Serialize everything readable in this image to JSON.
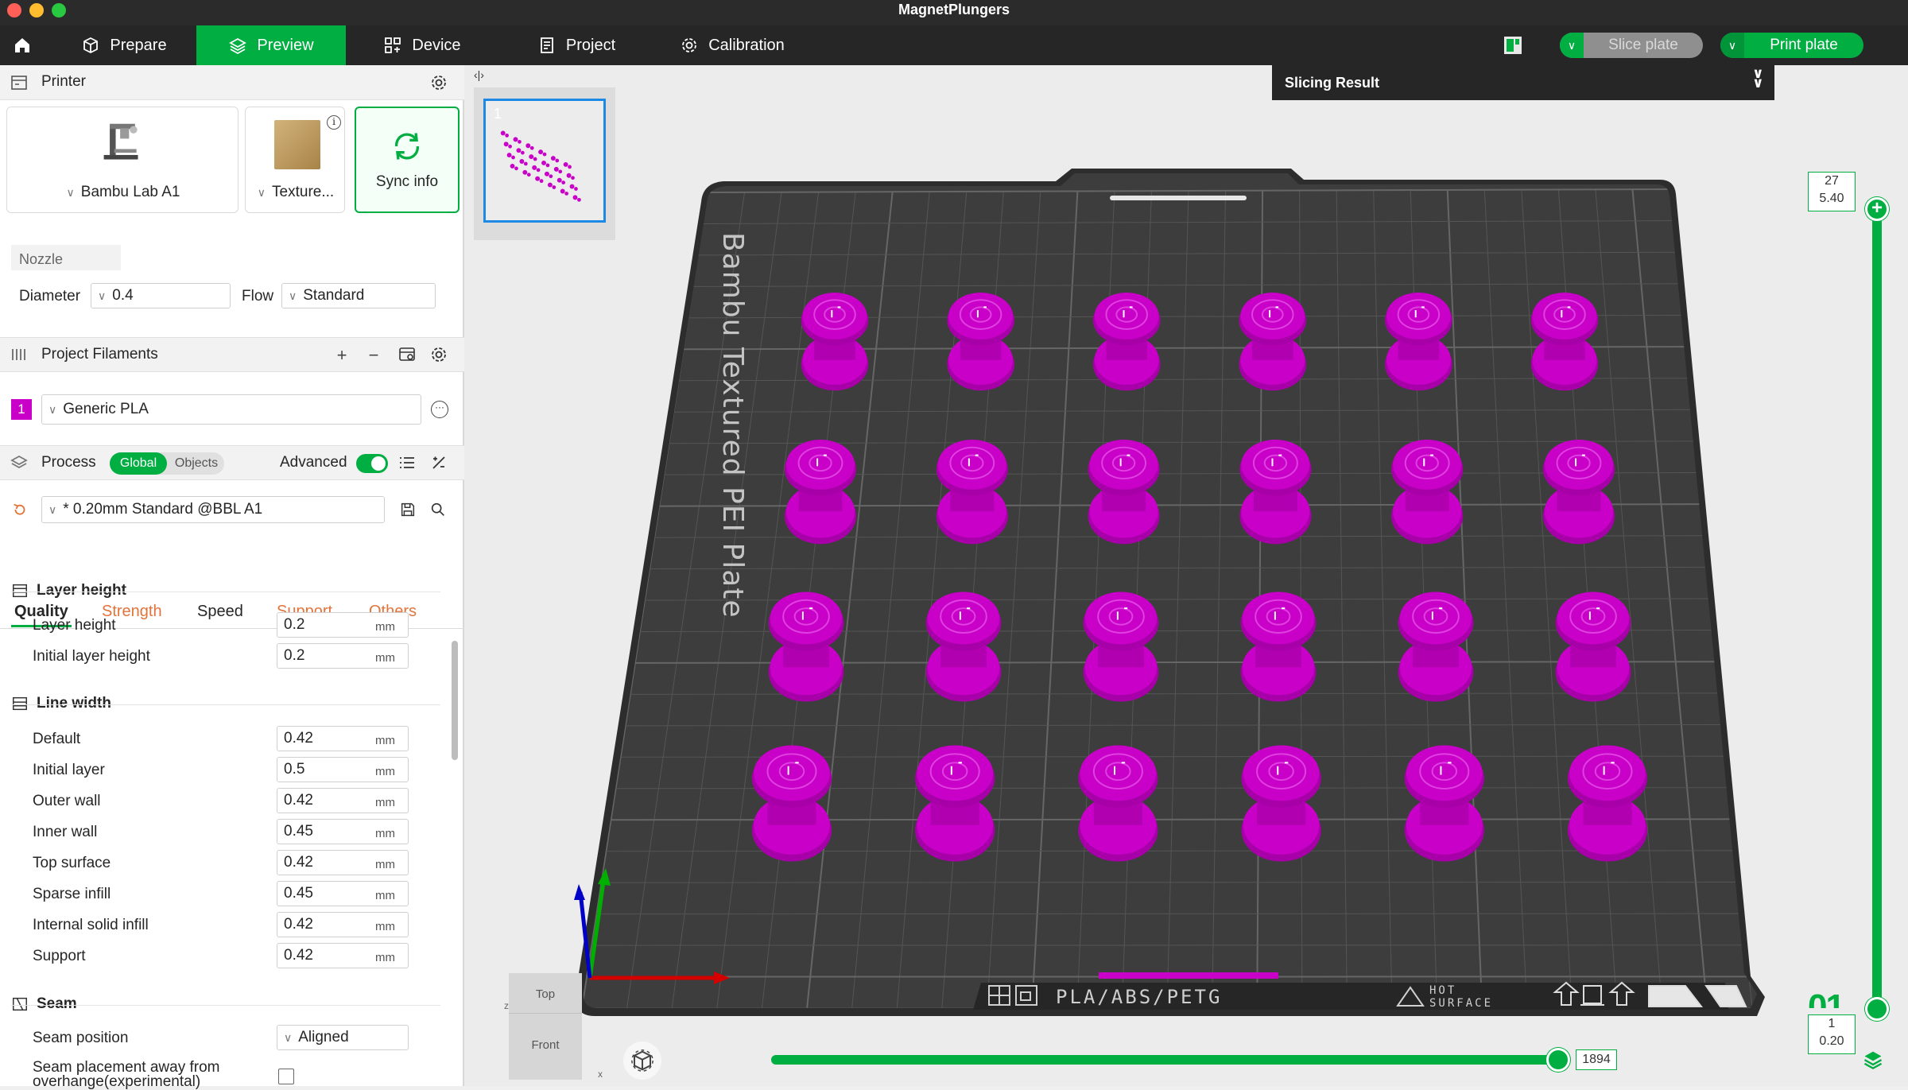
{
  "window": {
    "title": "MagnetPlungers"
  },
  "colors": {
    "accent": "#00ae42",
    "filament": "#c800c8",
    "plate": "#3d3d3d",
    "dark": "#262626"
  },
  "nav": {
    "tabs": [
      {
        "label": "Prepare",
        "icon": "cube-icon"
      },
      {
        "label": "Preview",
        "icon": "layers-icon"
      },
      {
        "label": "Device",
        "icon": "device-icon"
      },
      {
        "label": "Project",
        "icon": "document-icon"
      },
      {
        "label": "Calibration",
        "icon": "gear-icon"
      }
    ],
    "slice_label": "Slice plate",
    "print_label": "Print plate"
  },
  "printer": {
    "header": "Printer",
    "printer_name": "Bambu Lab A1",
    "plate_type": "Texture...",
    "sync_label": "Sync info",
    "nozzle_label": "Nozzle",
    "diameter_label": "Diameter",
    "diameter_value": "0.4",
    "flow_label": "Flow",
    "flow_value": "Standard"
  },
  "filaments": {
    "header": "Project Filaments",
    "items": [
      {
        "index": "1",
        "name": "Generic PLA",
        "color": "#c800c8"
      }
    ]
  },
  "process": {
    "header": "Process",
    "global_label": "Global",
    "objects_label": "Objects",
    "advanced_label": "Advanced",
    "advanced_on": true,
    "preset": "* 0.20mm Standard @BBL A1",
    "tabs": [
      "Quality",
      "Strength",
      "Speed",
      "Support",
      "Others"
    ],
    "active_tab": "Quality"
  },
  "settings": {
    "unit": "mm",
    "layer_height": {
      "title": "Layer height",
      "rows": [
        {
          "label": "Layer height",
          "value": "0.2"
        },
        {
          "label": "Initial layer height",
          "value": "0.2"
        }
      ]
    },
    "line_width": {
      "title": "Line width",
      "rows": [
        {
          "label": "Default",
          "value": "0.42"
        },
        {
          "label": "Initial layer",
          "value": "0.5"
        },
        {
          "label": "Outer wall",
          "value": "0.42"
        },
        {
          "label": "Inner wall",
          "value": "0.45"
        },
        {
          "label": "Top surface",
          "value": "0.42"
        },
        {
          "label": "Sparse infill",
          "value": "0.45"
        },
        {
          "label": "Internal solid infill",
          "value": "0.42"
        },
        {
          "label": "Support",
          "value": "0.42"
        }
      ]
    },
    "seam": {
      "title": "Seam",
      "position_label": "Seam position",
      "position_value": "Aligned",
      "away_label": "Seam placement away from",
      "away_label_2": "overhange(experimental)"
    }
  },
  "viewport": {
    "plate_number": "1",
    "slicing_result": "Slicing Result",
    "plate_name": "Bambu Textured PEI Plate",
    "plate_materials": "PLA/ABS/PETG",
    "plate_hot": "HOT",
    "plate_surface": "SURFACE",
    "layer_top_index": "27",
    "layer_top_height": "5.40",
    "layer_bottom_index": "1",
    "layer_bottom_height": "0.20",
    "layer_ghost": "01",
    "move_value": "1894",
    "move_fraction": 0.99,
    "layer_fraction": 1.0,
    "view_top": "Top",
    "view_front": "Front",
    "axis_x": "x",
    "axis_z": "z"
  }
}
